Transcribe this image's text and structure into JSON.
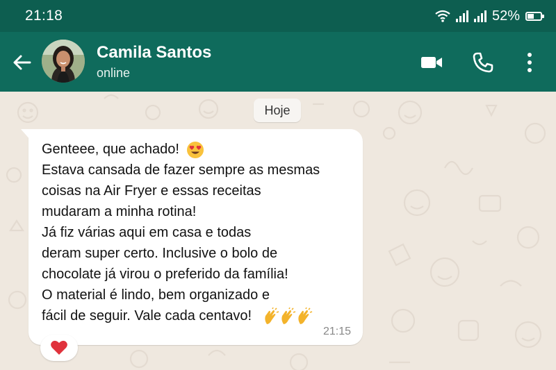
{
  "status_bar": {
    "time": "21:18",
    "battery_percent": "52%",
    "battery_level": 0.52,
    "icons": [
      "wifi-icon",
      "signal-icon",
      "signal-icon",
      "battery-icon"
    ]
  },
  "header": {
    "contact_name": "Camila Santos",
    "status": "online",
    "icons": [
      "back-arrow-icon",
      "video-call-icon",
      "phone-icon",
      "more-options-icon"
    ]
  },
  "chat": {
    "date_chip": "Hoje",
    "message": {
      "lines": [
        "Genteee, que achado!",
        "Estava cansada de fazer sempre as mesmas",
        "coisas na Air Fryer e essas receitas",
        "mudaram a minha rotina!",
        "Já fiz várias aqui em casa e todas",
        "deram super certo. Inclusive o bolo de",
        "chocolate já virou o preferido da família!",
        "O material é lindo, bem organizado e",
        "fácil de seguir. Vale cada centavo!"
      ],
      "emojis": [
        "heart-eyes-emoji",
        "clapping-hands-emoji"
      ],
      "time": "21:15",
      "reaction": "heart-emoji"
    }
  },
  "colors": {
    "status_bar": "#0d5e50",
    "header": "#0f6b5c",
    "chat_background": "#efe8df",
    "bubble": "#ffffff",
    "heart": "#e0323c"
  }
}
